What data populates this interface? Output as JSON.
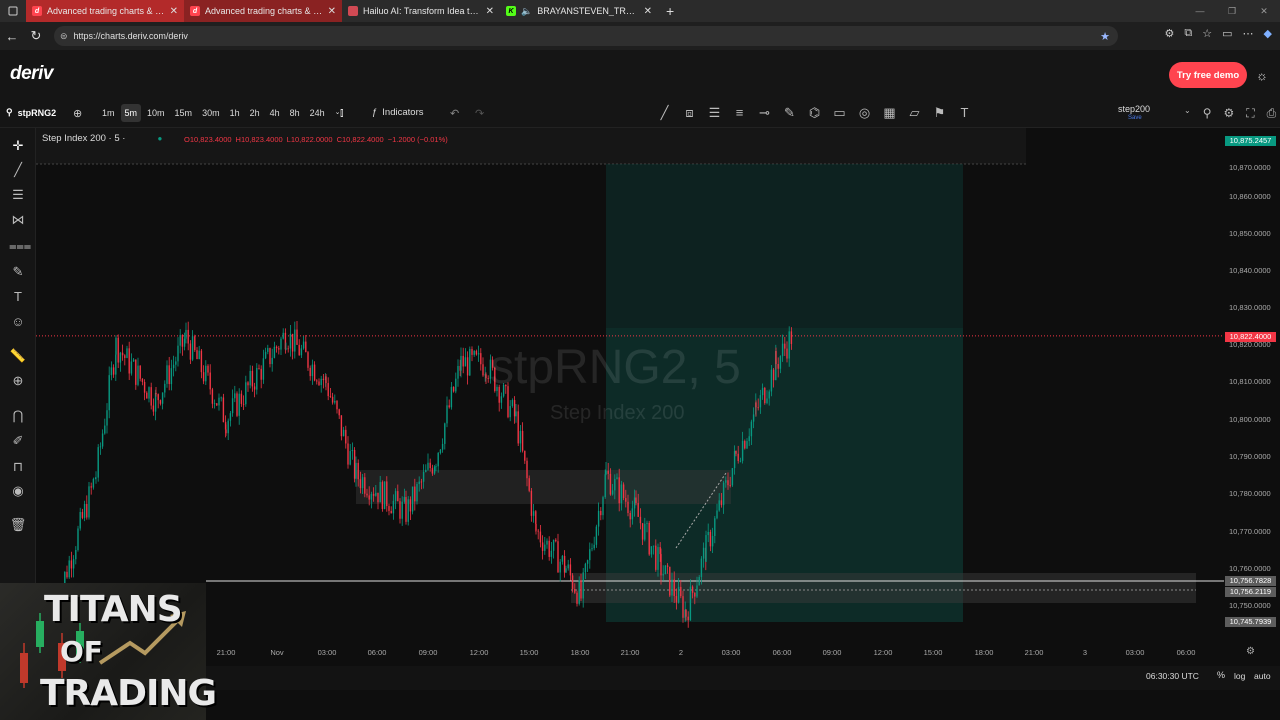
{
  "browser": {
    "tabs": [
      {
        "title": "Advanced trading charts & tools |",
        "icon": "deriv-favicon-icon",
        "icon_letter": "d"
      },
      {
        "title": "Advanced trading charts & tools |",
        "icon": "deriv-favicon-icon",
        "icon_letter": "d"
      },
      {
        "title": "Hailuo AI: Transform Idea to Visu",
        "icon": "hailuo-favicon-icon",
        "icon_letter": ""
      },
      {
        "title": "BRAYANSTEVEN_TRADER Str",
        "icon": "kick-favicon-icon",
        "icon_letter": "K"
      }
    ],
    "url": "https://charts.deriv.com/deriv"
  },
  "header": {
    "logo": "deriv",
    "demo_button": "Try free demo"
  },
  "toolbar": {
    "symbol": "stpRNG2",
    "intervals": [
      "1m",
      "5m",
      "10m",
      "15m",
      "30m",
      "1h",
      "2h",
      "4h",
      "8h",
      "24h"
    ],
    "selected_interval": "5m",
    "indicators_label": "Indicators",
    "account": "step200",
    "account_sub": "Save"
  },
  "legend": {
    "title": "Step Index 200 · 5 ·",
    "open": "O10,823.4000",
    "high": "H10,823.4000",
    "low": "L10,822.0000",
    "close": "C10,822.4000",
    "change": "−1.2000 (−0.01%)"
  },
  "watermark": {
    "line1": "stpRNG2, 5",
    "line2": "Step Index 200"
  },
  "price_scale": {
    "ticks": [
      "10,870.0000",
      "10,860.0000",
      "10,850.0000",
      "10,840.0000",
      "10,830.0000",
      "10,820.0000",
      "10,810.0000",
      "10,800.0000",
      "10,790.0000",
      "10,780.0000",
      "10,770.0000",
      "10,760.0000",
      "10,750.0000"
    ],
    "badges": [
      {
        "label": "10,875.2457",
        "color": "#089981"
      },
      {
        "label": "10,822.4000",
        "color": "#f23645"
      },
      {
        "label": "10,756.7828",
        "color": "#5d5d5d"
      },
      {
        "label": "10,756.2119",
        "color": "#5d5d5d"
      },
      {
        "label": "10,745.7939",
        "color": "#5d5d5d"
      }
    ]
  },
  "time_axis": {
    "ticks": [
      "21:00",
      "Nov",
      "03:00",
      "06:00",
      "09:00",
      "12:00",
      "15:00",
      "18:00",
      "21:00",
      "2",
      "03:00",
      "06:00",
      "09:00",
      "12:00",
      "15:00",
      "18:00",
      "21:00",
      "3",
      "03:00",
      "06:00"
    ]
  },
  "status": {
    "clock": "06:30:30 UTC",
    "percent": "%",
    "log": "log",
    "auto": "auto"
  },
  "overlay_logo": {
    "line1": "TITANS",
    "line2": "OF",
    "line3": "TRADING"
  },
  "colors": {
    "up": "#089981",
    "down": "#f23645",
    "brand": "#ff444f"
  }
}
